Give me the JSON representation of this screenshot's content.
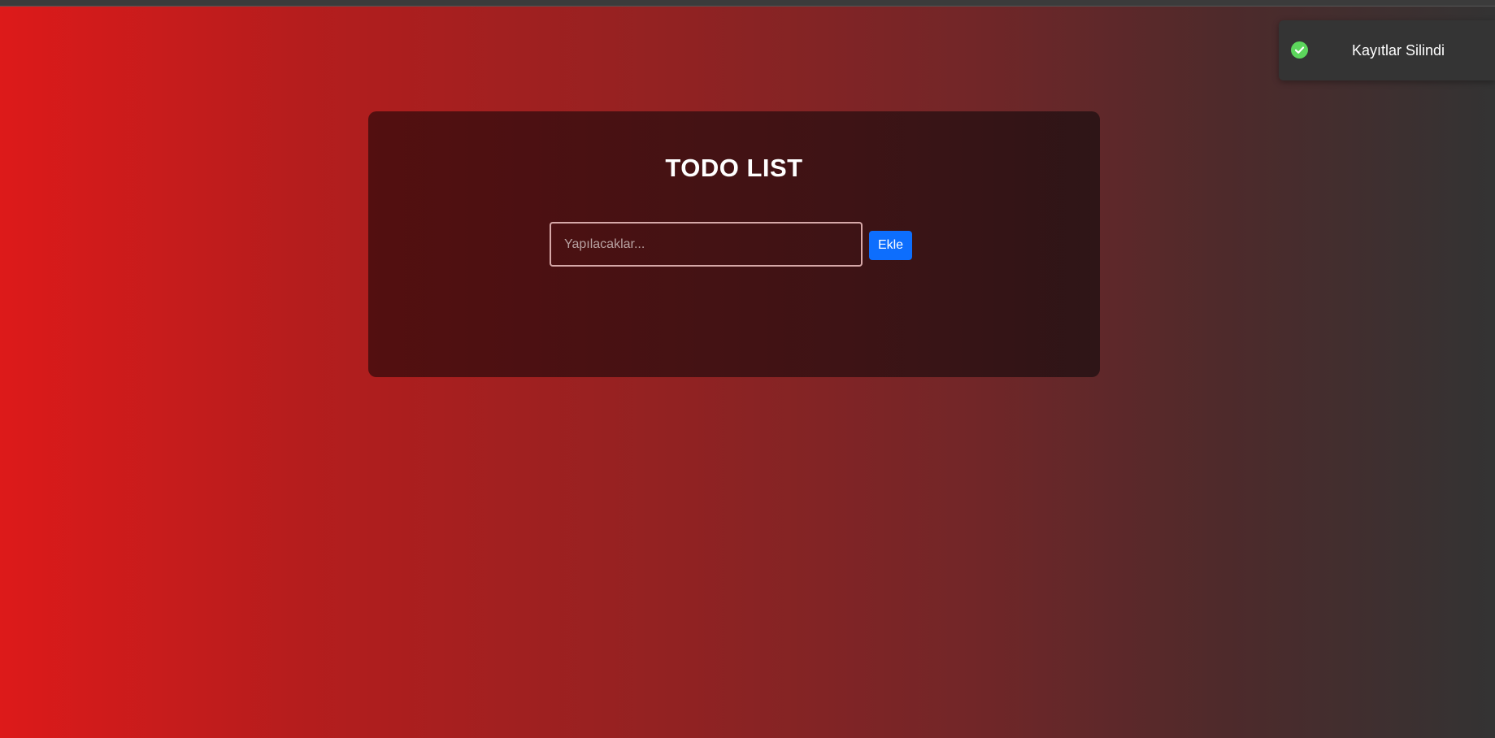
{
  "card": {
    "title": "TODO LIST",
    "input": {
      "placeholder": "Yapılacaklar...",
      "value": ""
    },
    "add_button_label": "Ekle"
  },
  "toast": {
    "icon": "check-circle-icon",
    "message": "Kayıtlar Silindi"
  },
  "colors": {
    "accent": "#0d6efd",
    "success": "#5cd65c",
    "background_start": "#dd1a1a",
    "background_end": "#333333"
  }
}
